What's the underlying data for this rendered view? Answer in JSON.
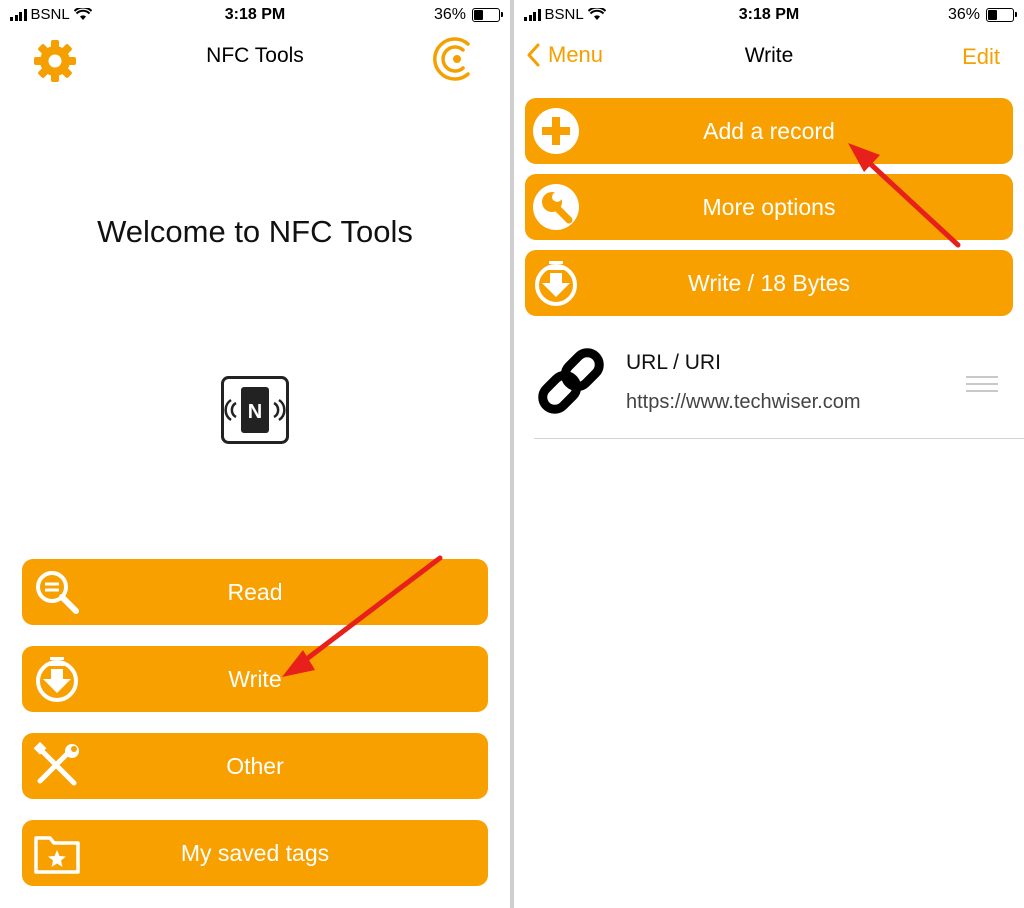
{
  "status_bar": {
    "carrier": "BSNL",
    "time": "3:18 PM",
    "battery": "36%"
  },
  "left_screen": {
    "nav_title": "NFC Tools",
    "welcome": "Welcome to NFC Tools",
    "nfc_badge_letter": "N",
    "buttons": [
      {
        "label": "Read",
        "icon": "magnifier-icon"
      },
      {
        "label": "Write",
        "icon": "download-circle-icon"
      },
      {
        "label": "Other",
        "icon": "tools-icon"
      },
      {
        "label": "My saved tags",
        "icon": "folder-star-icon"
      }
    ]
  },
  "right_screen": {
    "back_label": "Menu",
    "nav_title": "Write",
    "edit_label": "Edit",
    "buttons": [
      {
        "label": "Add a record",
        "icon": "plus-circle-icon"
      },
      {
        "label": "More options",
        "icon": "wrench-circle-icon"
      },
      {
        "label": "Write / 18 Bytes",
        "icon": "download-circle-icon"
      }
    ],
    "record": {
      "type": "URL / URI",
      "value": "https://www.techwiser.com",
      "icon": "link-icon"
    }
  },
  "colors": {
    "accent": "#f7a000",
    "arrow": "#e8201c"
  }
}
